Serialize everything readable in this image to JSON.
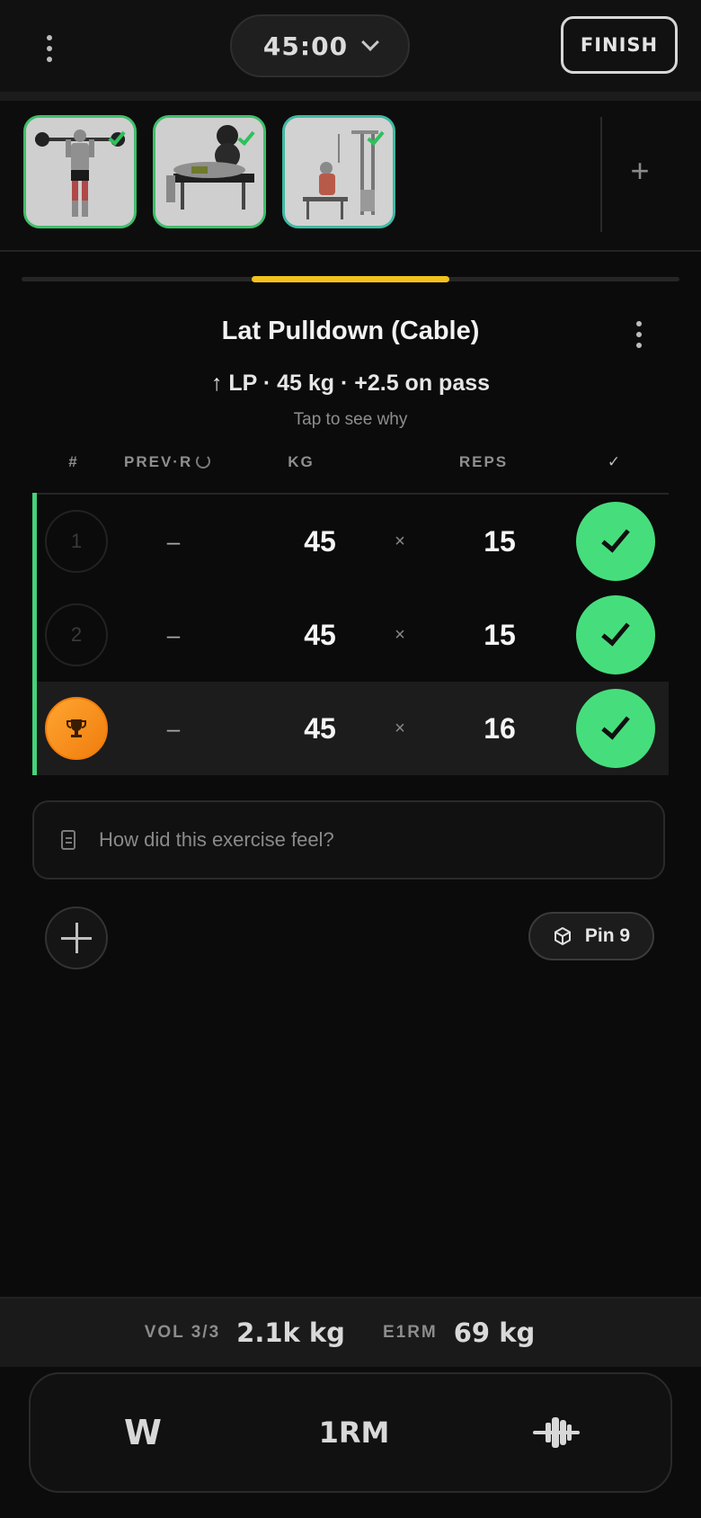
{
  "header": {
    "timer": "45:00",
    "finish_label": "FINISH"
  },
  "thumbnails": [
    {
      "name": "overhead press",
      "completed": true
    },
    {
      "name": "bench press",
      "completed": true
    },
    {
      "name": "lat pulldown",
      "completed": true
    }
  ],
  "exercise": {
    "title": "Lat Pulldown (Cable)",
    "rule": "↑ LP · 45 kg · +2.5 on pass",
    "why": "Tap to see why"
  },
  "columns": {
    "num": "#",
    "prev": "PREV·R",
    "kg": "KG",
    "reps": "REPS",
    "done": "✓"
  },
  "sets": [
    {
      "num": "1",
      "prev": "–",
      "kg": "45",
      "x": "×",
      "reps": "15",
      "done": true
    },
    {
      "num": "2",
      "prev": "–",
      "kg": "45",
      "x": "×",
      "reps": "15",
      "done": true
    },
    {
      "num": "",
      "prev": "–",
      "kg": "45",
      "x": "×",
      "reps": "16",
      "done": true,
      "pr": true
    }
  ],
  "notes": {
    "placeholder": "How did this exercise feel?"
  },
  "pin": {
    "label": "Pin 9"
  },
  "stats": {
    "vol_label": "VOL 3/3",
    "vol_value": "2.1k kg",
    "e1rm_label": "E1RM",
    "e1rm_value": "69 kg"
  },
  "tools": {
    "w": "W",
    "one_rm": "1RM"
  },
  "colors": {
    "accent_green": "#46de7c",
    "progress_yellow": "#f2c21b",
    "trophy_orange": "#f59320"
  },
  "progress": {
    "current_exercise": 3,
    "total_exercises": 3
  }
}
